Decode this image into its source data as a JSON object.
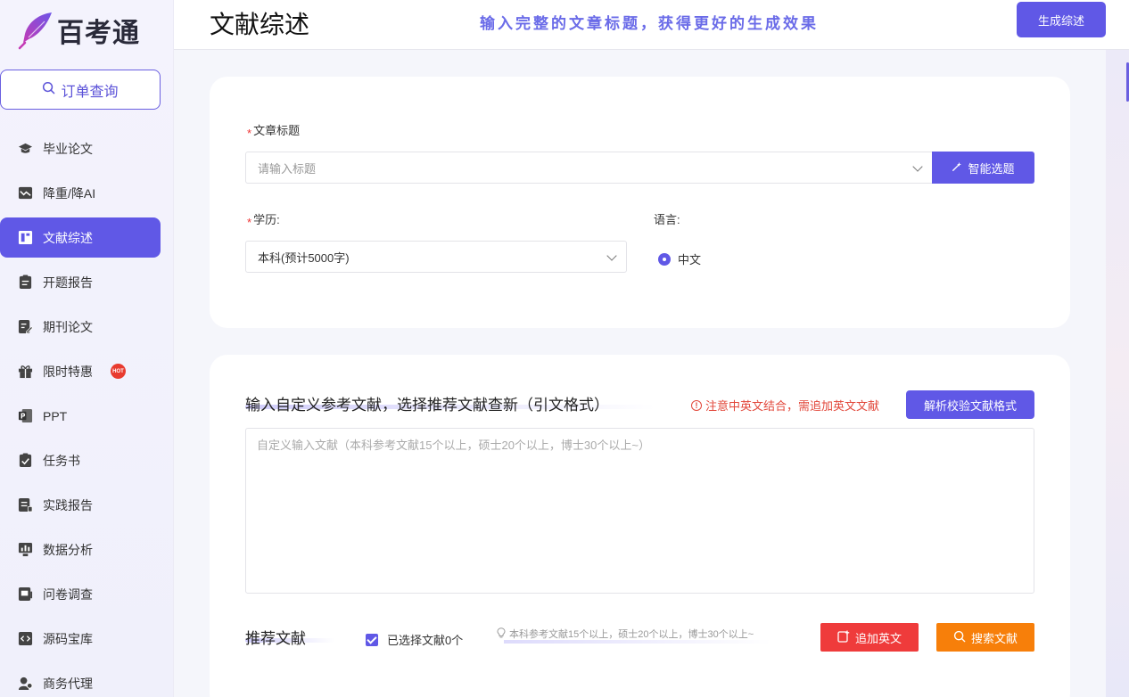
{
  "app": {
    "logo_text": "百考通"
  },
  "sidebar": {
    "order_query": "订单查询",
    "items": [
      {
        "label": "毕业论文",
        "icon": "graduation-cap-icon"
      },
      {
        "label": "降重/降AI",
        "icon": "trend-chart-icon"
      },
      {
        "label": "文献综述",
        "icon": "book-icon",
        "active": true
      },
      {
        "label": "开题报告",
        "icon": "clipboard-icon"
      },
      {
        "label": "期刊论文",
        "icon": "edit-document-icon"
      },
      {
        "label": "限时特惠",
        "icon": "gift-icon",
        "badge": "HOT"
      },
      {
        "label": "PPT",
        "icon": "ppt-icon"
      },
      {
        "label": "任务书",
        "icon": "task-clipboard-icon"
      },
      {
        "label": "实践报告",
        "icon": "report-icon"
      },
      {
        "label": "数据分析",
        "icon": "monitor-chart-icon"
      },
      {
        "label": "问卷调查",
        "icon": "survey-icon"
      },
      {
        "label": "源码宝库",
        "icon": "code-icon"
      },
      {
        "label": "商务代理",
        "icon": "agent-icon"
      }
    ]
  },
  "header": {
    "title": "文献综述",
    "tip": "输入完整的文章标题，获得更好的生成效果",
    "generate_button": "生成综述"
  },
  "form": {
    "title_label": "文章标题",
    "title_placeholder": "请输入标题",
    "smart_topic_button": "智能选题",
    "edu_label": "学历:",
    "edu_value": "本科(预计5000字)",
    "lang_label": "语言:",
    "lang_option": "中文"
  },
  "references": {
    "section_title": "输入自定义参考文献，选择推荐文献查新（引文格式）",
    "warning": "注意中英文结合，需追加英文文献",
    "parse_button": "解析校验文献格式",
    "textarea_placeholder": "自定义输入文献（本科参考文献15个以上，硕士20个以上，博士30个以上~）",
    "recommend_title": "推荐文献",
    "selected_text": "已选择文献0个",
    "hint": "本科参考文献15个以上，硕士20个以上，博士30个以上~",
    "add_english_button": "追加英文",
    "search_button": "搜索文献"
  },
  "colors": {
    "accent": "#6058e6",
    "red": "#ef3b3b",
    "orange": "#f77f0a",
    "tip": "#6a6be8"
  }
}
